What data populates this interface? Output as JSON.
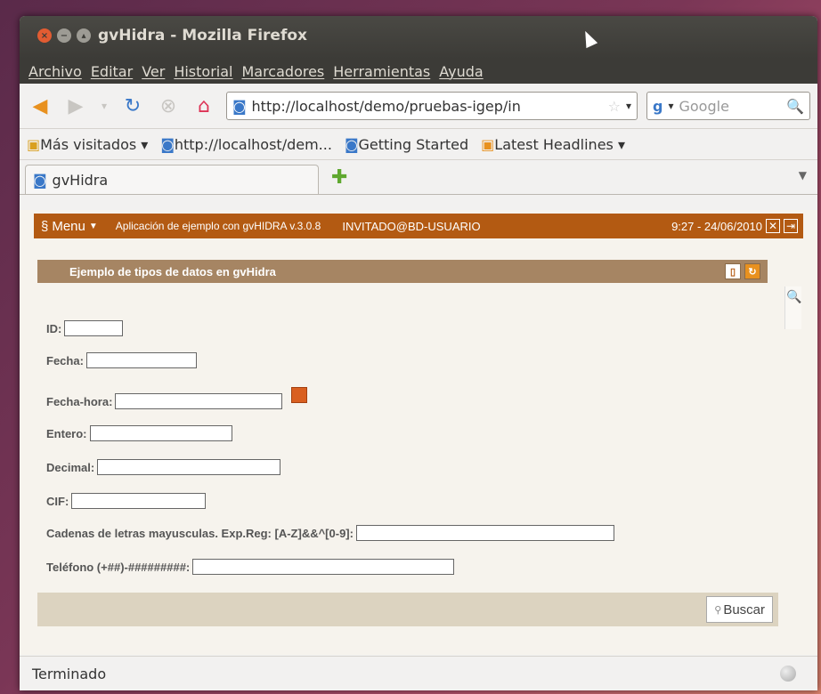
{
  "window": {
    "title": "gvHidra - Mozilla Firefox"
  },
  "menubar": [
    "Archivo",
    "Editar",
    "Ver",
    "Historial",
    "Marcadores",
    "Herramientas",
    "Ayuda"
  ],
  "nav": {
    "url": "http://localhost/demo/pruebas-igep/in",
    "search_placeholder": "Google"
  },
  "bookmarks": [
    "Más visitados ▾",
    "http://localhost/dem...",
    "Getting Started",
    "Latest Headlines ▾"
  ],
  "tab": {
    "label": "gvHidra"
  },
  "app": {
    "menu_label": "Menu",
    "name": "Aplicación de ejemplo con gvHIDRA  v.3.0.8",
    "user": "INVITADO@BD-USUARIO",
    "time": "9:27 - 24/06/2010"
  },
  "panel": {
    "title": "Ejemplo de tipos de datos en gvHidra"
  },
  "fields": {
    "id": "ID:",
    "fecha": "Fecha:",
    "fecha_hora": "Fecha-hora:",
    "entero": "Entero:",
    "decimal": "Decimal:",
    "cif": "CIF:",
    "cadenas": "Cadenas de letras mayusculas. Exp.Reg: [A-Z]&&^[0-9]:",
    "telefono": "Teléfono (+##)-#########:"
  },
  "buttons": {
    "buscar": "Buscar"
  },
  "status": {
    "text": "Terminado"
  },
  "colors": {
    "app_header": "#b35a12",
    "panel_title": "#a68563",
    "footer_bar": "#dcd3c0"
  }
}
